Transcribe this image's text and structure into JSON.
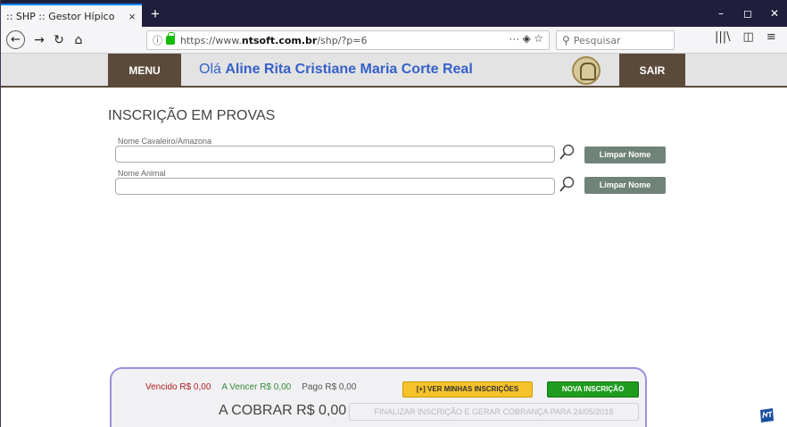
{
  "browser": {
    "tab_title": ":: SHP :: Gestor Hípico",
    "tab_close": "×",
    "new_tab": "+",
    "url_prefix": "https://www.",
    "url_domain": "ntsoft.com.br",
    "url_path": "/shp/?p=6",
    "url_actions": "··· ◈ ☆",
    "search_placeholder": "Pesquisar",
    "win_min": "–",
    "win_max": "◻",
    "win_close": "✕"
  },
  "header": {
    "menu_label": "MENU",
    "greeting_prefix": "Olá ",
    "user_name": "Aline Rita Cristiane Maria Corte Real",
    "logout_label": "SAIR"
  },
  "main": {
    "title": "INSCRIÇÃO EM PROVAS",
    "rider_label": "Nome Cavaleiro/Amazona",
    "rider_value": "",
    "animal_label": "Nome Animal",
    "animal_value": "",
    "clear_label": "Limpar Nome"
  },
  "summary": {
    "vencido": "Vencido R$ 0,00",
    "a_vencer": "A Vencer R$ 0,00",
    "pago": "Pago R$ 0,00",
    "ver_label": "[+] VER MINHAS INSCRIÇÕES",
    "nova_label": "NOVA INSCRIÇÃO",
    "cobrar": "A COBRAR R$ 0,00",
    "finalizar_label": "FINALIZAR INSCRIÇÃO E GERAR COBRANÇA PARA 24/05/2018"
  },
  "colors": {
    "header_brown": "#5b4a3a",
    "greeting_blue": "#3561c8",
    "clear_button": "#6f8379",
    "ver_button": "#f5c22a",
    "nova_button": "#1e9c1e",
    "panel_border": "#9d8ee0"
  },
  "icons": [
    "back-arrow-icon",
    "forward-arrow-icon",
    "reload-icon",
    "home-icon",
    "info-icon",
    "lock-icon",
    "search-icon",
    "library-icon",
    "sidebar-icon",
    "menu-icon",
    "magnifier-icon"
  ]
}
